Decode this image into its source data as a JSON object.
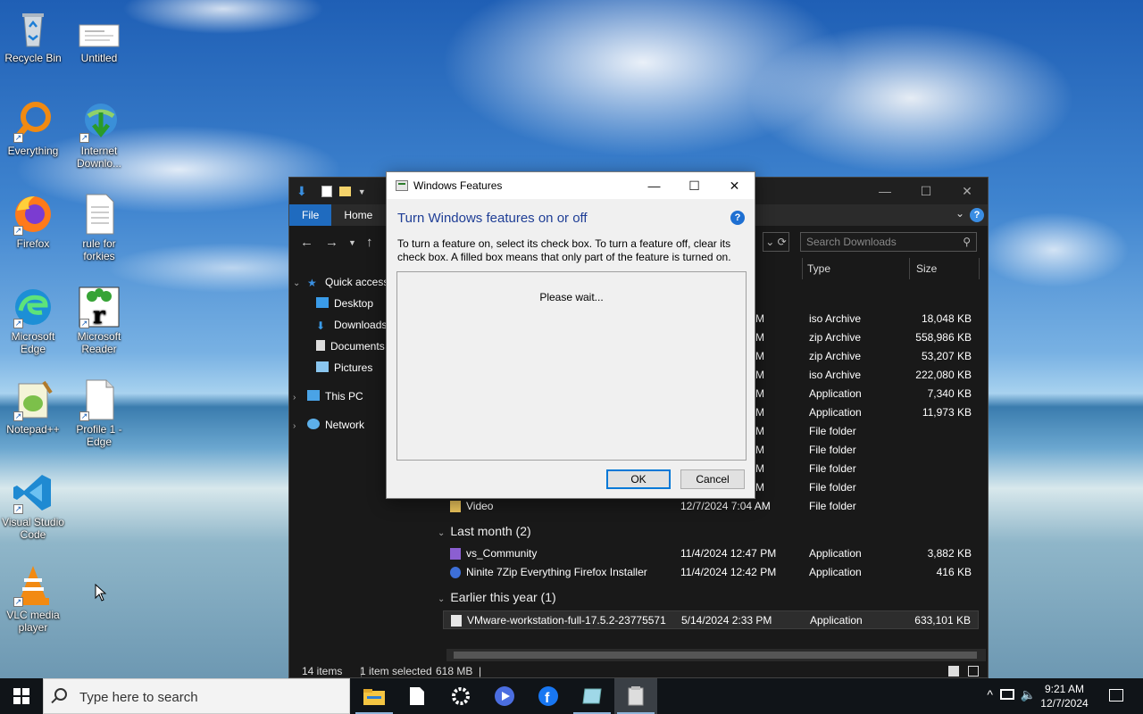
{
  "desktop": {
    "icons": [
      {
        "label": "Recycle Bin",
        "icon": "recycle-bin-icon"
      },
      {
        "label": "Untitled",
        "icon": "document-thumbnail-icon"
      },
      {
        "label": "Everything",
        "icon": "everything-search-icon"
      },
      {
        "label": "Internet Downlo...",
        "icon": "internet-download-manager-icon"
      },
      {
        "label": "Firefox",
        "icon": "firefox-icon"
      },
      {
        "label": "rule for forkies",
        "icon": "text-file-icon"
      },
      {
        "label": "Microsoft Edge",
        "icon": "edge-icon"
      },
      {
        "label": "Microsoft Reader",
        "icon": "reader-icon"
      },
      {
        "label": "Notepad++",
        "icon": "notepadpp-icon"
      },
      {
        "label": "Profile 1 - Edge",
        "icon": "blank-file-icon"
      },
      {
        "label": "Visual Studio Code",
        "icon": "vscode-icon"
      },
      {
        "label": "VLC media player",
        "icon": "vlc-icon"
      }
    ]
  },
  "explorer": {
    "ribbon": {
      "file_tab": "File",
      "home_tab": "Home"
    },
    "search_placeholder": "Search Downloads",
    "columns": {
      "type": "Type",
      "size": "Size"
    },
    "nav": {
      "quick_access": "Quick access",
      "desktop": "Desktop",
      "downloads": "Downloads",
      "documents": "Documents",
      "pictures": "Pictures",
      "this_pc": "This PC",
      "network": "Network"
    },
    "rows_partial": [
      {
        "date": "M",
        "type": "iso Archive",
        "size": "18,048 KB"
      },
      {
        "date": "M",
        "type": "zip Archive",
        "size": "558,986 KB"
      },
      {
        "date": "M",
        "type": "zip Archive",
        "size": "53,207 KB"
      },
      {
        "date": "M",
        "type": "iso Archive",
        "size": "222,080 KB"
      },
      {
        "date": "M",
        "type": "Application",
        "size": "7,340 KB"
      },
      {
        "date": "M",
        "type": "Application",
        "size": "11,973 KB"
      },
      {
        "date": "M",
        "type": "File folder",
        "size": ""
      },
      {
        "date": "M",
        "type": "File folder",
        "size": ""
      },
      {
        "date": "M",
        "type": "File folder",
        "size": ""
      },
      {
        "date": "M",
        "type": "File folder",
        "size": ""
      }
    ],
    "video_row": {
      "name": "Video",
      "date": "12/7/2024 7:04 AM",
      "type": "File folder",
      "size": ""
    },
    "group_last_month": "Last month (2)",
    "last_month_rows": [
      {
        "name": "vs_Community",
        "date": "11/4/2024 12:47 PM",
        "type": "Application",
        "size": "3,882 KB"
      },
      {
        "name": "Ninite 7Zip Everything Firefox Installer",
        "date": "11/4/2024 12:42 PM",
        "type": "Application",
        "size": "416 KB"
      }
    ],
    "group_earlier": "Earlier this year (1)",
    "earlier_row": {
      "name": "VMware-workstation-full-17.5.2-23775571",
      "date": "5/14/2024 2:33 PM",
      "type": "Application",
      "size": "633,101 KB"
    },
    "status": {
      "items": "14 items",
      "selected": "1 item selected",
      "size": "618 MB"
    }
  },
  "dialog": {
    "title": "Windows Features",
    "heading": "Turn Windows features on or off",
    "description": "To turn a feature on, select its check box. To turn a feature off, clear its check box. A filled box means that only part of the feature is turned on.",
    "wait_text": "Please wait...",
    "ok_label": "OK",
    "cancel_label": "Cancel"
  },
  "taskbar": {
    "search_placeholder": "Type here to search",
    "apps": [
      "file-explorer-icon",
      "notepad-icon",
      "settings-icon",
      "media-player-icon",
      "facebook-icon",
      "windows-features-icon",
      "open-app-icon"
    ],
    "time": "9:21 AM",
    "date": "12/7/2024"
  },
  "colors": {
    "accent": "#0078d7",
    "explorer_bg": "#191919",
    "taskbar_bg": "#101418",
    "dialog_heading": "#1f3e96"
  }
}
